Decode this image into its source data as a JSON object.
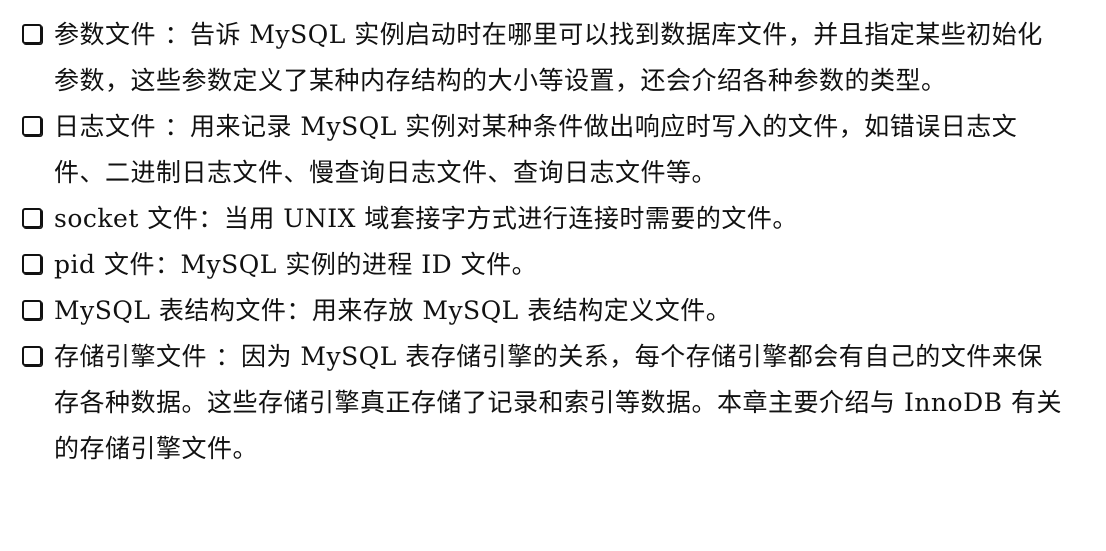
{
  "items": [
    {
      "text": "参数文件 ：告诉 MySQL 实例启动时在哪里可以找到数据库文件，并且指定某些初始化参数，这些参数定义了某种内存结构的大小等设置，还会介绍各种参数的类型。"
    },
    {
      "text": "日志文件 ：用来记录 MySQL 实例对某种条件做出响应时写入的文件，如错误日志文件、二进制日志文件、慢查询日志文件、查询日志文件等。"
    },
    {
      "text": "socket 文件：当用 UNIX 域套接字方式进行连接时需要的文件。"
    },
    {
      "text": "pid 文件：MySQL 实例的进程 ID 文件。"
    },
    {
      "text": "MySQL 表结构文件：用来存放 MySQL 表结构定义文件。"
    },
    {
      "text": "存储引擎文件 ：因为 MySQL 表存储引擎的关系，每个存储引擎都会有自己的文件来保存各种数据。这些存储引擎真正存储了记录和索引等数据。本章主要介绍与 InnoDB 有关的存储引擎文件。"
    }
  ]
}
